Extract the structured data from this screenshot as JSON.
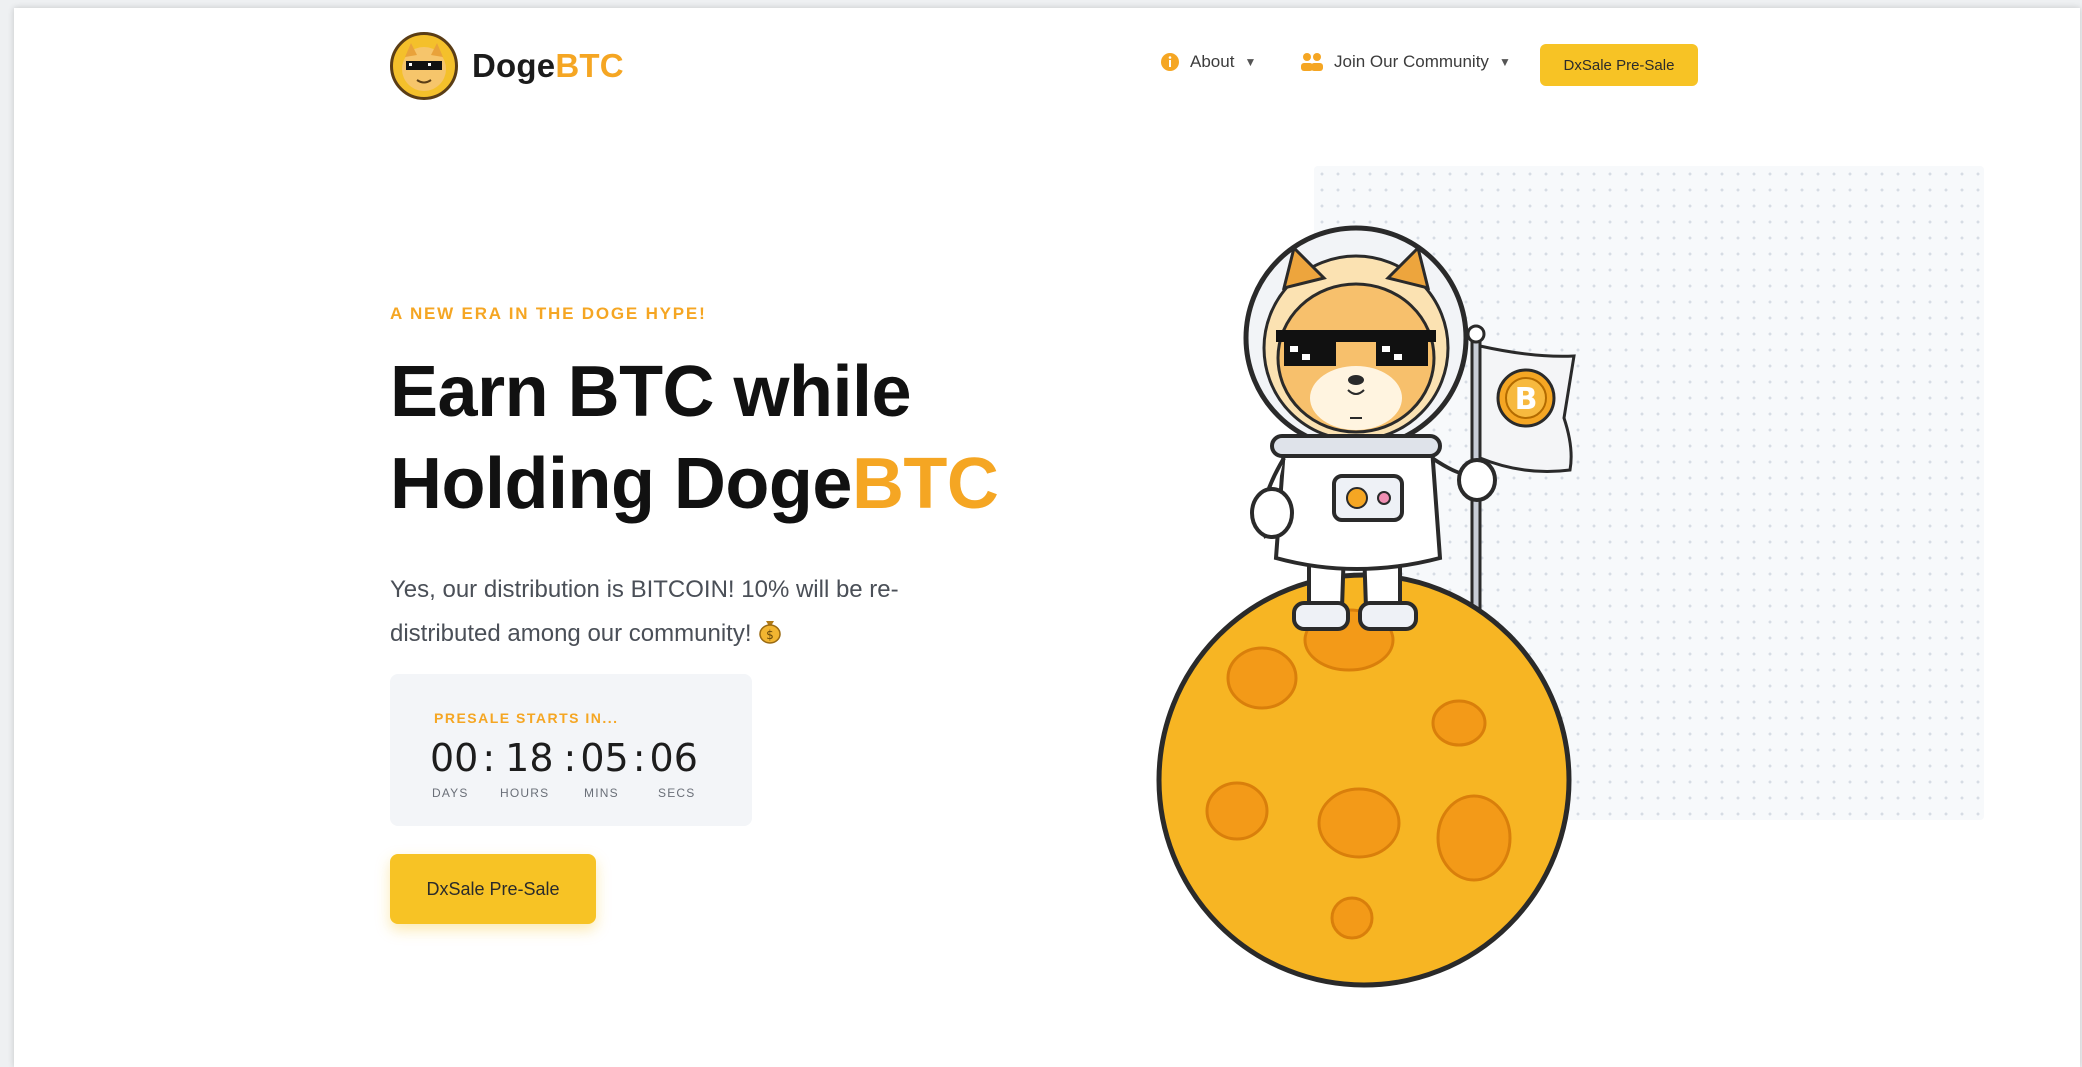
{
  "header": {
    "brand_main": "Doge",
    "brand_accent": "BTC",
    "nav": [
      {
        "label": "About",
        "icon": "info-icon"
      },
      {
        "label": "Join Our Community",
        "icon": "community-icon"
      }
    ],
    "cta_label": "DxSale Pre-Sale"
  },
  "hero": {
    "eyebrow": "A NEW ERA IN THE DOGE HYPE!",
    "headline_line1": "Earn BTC while",
    "headline_line2_main": "Holding Doge",
    "headline_line2_accent": "BTC",
    "subtext": "Yes, our distribution is BITCOIN! 10% will be re-distributed among our community!",
    "subtext_icon": "money-bag-icon",
    "cta_label": "DxSale Pre-Sale"
  },
  "countdown": {
    "label": "PRESALE STARTS IN...",
    "days": "00",
    "hours": "18",
    "mins": "05",
    "secs": "06",
    "days_label": "DAYS",
    "hours_label": "HOURS",
    "mins_label": "MINS",
    "secs_label": "SECS"
  },
  "colors": {
    "accent": "#f5a623",
    "button": "#f7c325",
    "moon": "#f7b523",
    "text_dark": "#111111"
  }
}
